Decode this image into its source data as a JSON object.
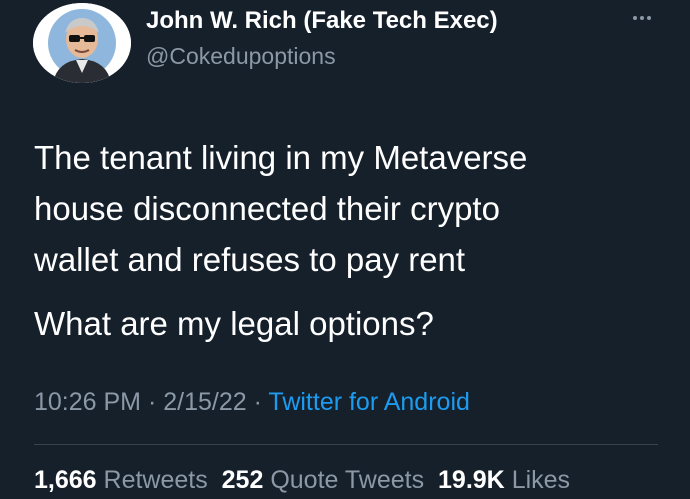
{
  "author": {
    "display_name": "John W. Rich (Fake Tech Exec)",
    "handle": "@Cokedupoptions",
    "avatar_icon": "profile-avatar-icon"
  },
  "more_icon": "more-options-icon",
  "tweet": {
    "lines": [
      "The tenant living in my Metaverse",
      "house disconnected their crypto",
      "wallet and refuses to pay rent",
      "What are my legal options?"
    ]
  },
  "meta": {
    "time": "10:26 PM",
    "sep1": " · ",
    "date": "2/15/22",
    "sep2": " · ",
    "source": "Twitter for Android"
  },
  "stats": {
    "retweets_count": "1,666",
    "retweets_label": "Retweets",
    "quotes_count": "252",
    "quotes_label": "Quote Tweets",
    "likes_count": "19.9K",
    "likes_label": "Likes"
  },
  "colors": {
    "background": "#15202b",
    "text": "#ffffff",
    "secondary": "#8b98a5",
    "link": "#1d9bf0",
    "divider": "#38444d"
  }
}
